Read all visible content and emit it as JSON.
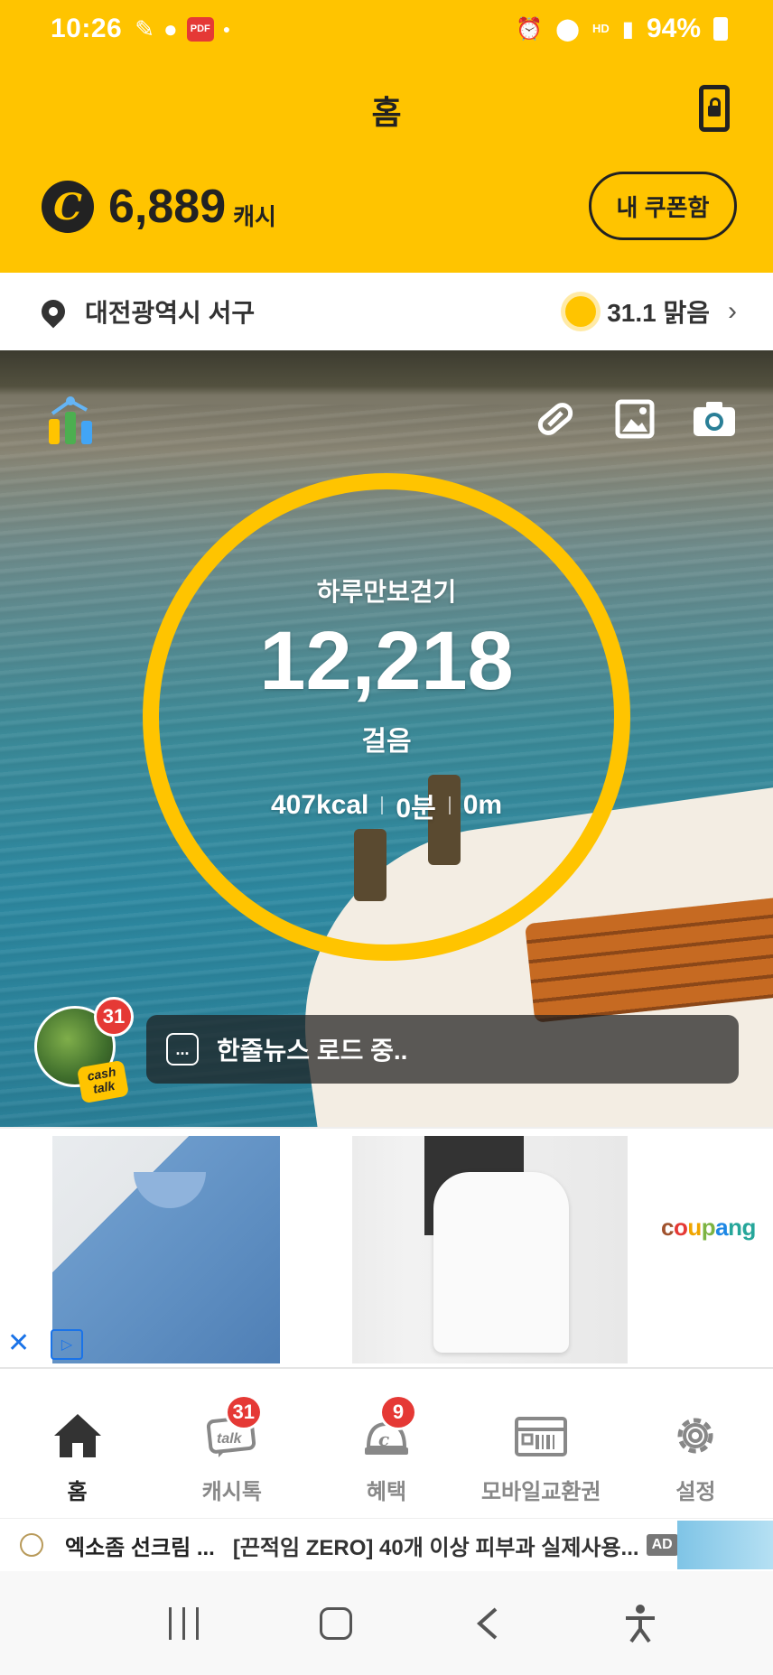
{
  "status_bar": {
    "time": "10:26",
    "battery": "94%",
    "hd_label": "HD",
    "pdf_label": "PDF"
  },
  "header": {
    "title": "홈",
    "cash_amount": "6,889",
    "cash_unit": "캐시",
    "coin_symbol": "C",
    "coupon_button": "내 쿠폰함"
  },
  "location": {
    "region": "대전광역시 서구",
    "weather": "31.1 맑음"
  },
  "hero": {
    "ring_title": "하루만보걷기",
    "steps": "12,218",
    "steps_unit": "걸음",
    "kcal": "407kcal",
    "minutes": "0분",
    "distance": "0m",
    "news_badge": "31",
    "news_text": "한줄뉴스 로드 중..",
    "news_dots": "...",
    "cashtalk_logo": "cash talk"
  },
  "ad_banner": {
    "brand": "coupang",
    "close_label": "✕",
    "play_label": "▷"
  },
  "bottom_nav": {
    "items": [
      {
        "label": "홈",
        "icon": "home-icon",
        "badge": ""
      },
      {
        "label": "캐시톡",
        "icon": "cashtalk-icon",
        "badge": "31"
      },
      {
        "label": "혜택",
        "icon": "benefit-icon",
        "badge": "9"
      },
      {
        "label": "모바일교환권",
        "icon": "voucher-icon",
        "badge": ""
      },
      {
        "label": "설정",
        "icon": "settings-icon",
        "badge": ""
      }
    ]
  },
  "ad_strip": {
    "brand": "엑소좀 선크림 ...",
    "description": "[끈적임 ZERO] 40개 이상 피부과 실제사용...",
    "ad_tag": "AD"
  },
  "colors": {
    "brand_yellow": "#FFC400",
    "badge_red": "#e53935"
  }
}
